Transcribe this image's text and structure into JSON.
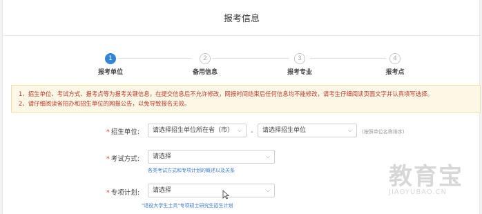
{
  "header": {
    "title": "报考信息"
  },
  "steps": [
    {
      "num": "1",
      "label": "报考单位",
      "active": true
    },
    {
      "num": "2",
      "label": "备用信息",
      "active": false
    },
    {
      "num": "3",
      "label": "报考专业",
      "active": false
    },
    {
      "num": "4",
      "label": "报考点",
      "active": false
    }
  ],
  "notice": {
    "line1": "1、招生单位、考试方式、报考点等为报考关键信息，在提交信息后不允许修改，网报时间结束后任何信息均不能修改，请考生仔细阅读页面文字并认真填写选择。",
    "line2": "2、请仔细阅读省招办和招生单位的网报公告，以免导致报名无效。"
  },
  "form": {
    "unit": {
      "label": "招生单位:",
      "province_select": "请选择招生单位所在省（市）",
      "unit_select": "请选择招生单位",
      "separator": "-",
      "hint": "(按照单位名称排序)"
    },
    "exam_mode": {
      "label": "考试方式:",
      "select": "请选择",
      "link": "各类考试方式和专项计划的概述以及关系"
    },
    "special_plan": {
      "label": "专项计划:",
      "select": "请选择",
      "link": "\"退役大学生士兵\"专项硕士研究生招生计划"
    }
  },
  "watermark": {
    "cn": "教育宝",
    "en": "JIAOYUBAO.CN"
  },
  "colors": {
    "accent": "#3385d6",
    "required": "#e03a3a",
    "notice_text": "#c0392b",
    "notice_bg": "#fdf8e6"
  },
  "icons": {
    "select_arrow": "chevron-down-icon",
    "cursor": "mouse-pointer-icon"
  }
}
